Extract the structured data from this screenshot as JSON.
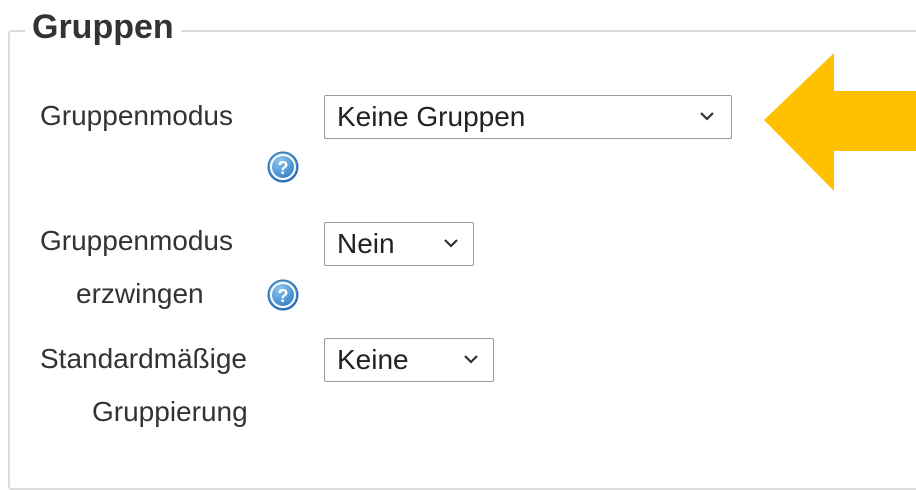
{
  "section": {
    "title": "Gruppen"
  },
  "fields": {
    "group_mode": {
      "label": "Gruppenmodus",
      "value": "Keine Gruppen"
    },
    "force_group_mode": {
      "label_line1": "Gruppenmodus",
      "label_line2": "erzwingen",
      "value": "Nein"
    },
    "default_grouping": {
      "label_line1": "Standardmäßige",
      "label_line2": "Gruppierung",
      "value": "Keine"
    }
  },
  "icons": {
    "help": "help-icon",
    "dropdown": "chevron-down-icon",
    "pointer_arrow": "arrow-left-icon"
  },
  "colors": {
    "arrow": "#FFC000",
    "help_icon": "#3A87C8",
    "border": "#DCDCDC"
  }
}
